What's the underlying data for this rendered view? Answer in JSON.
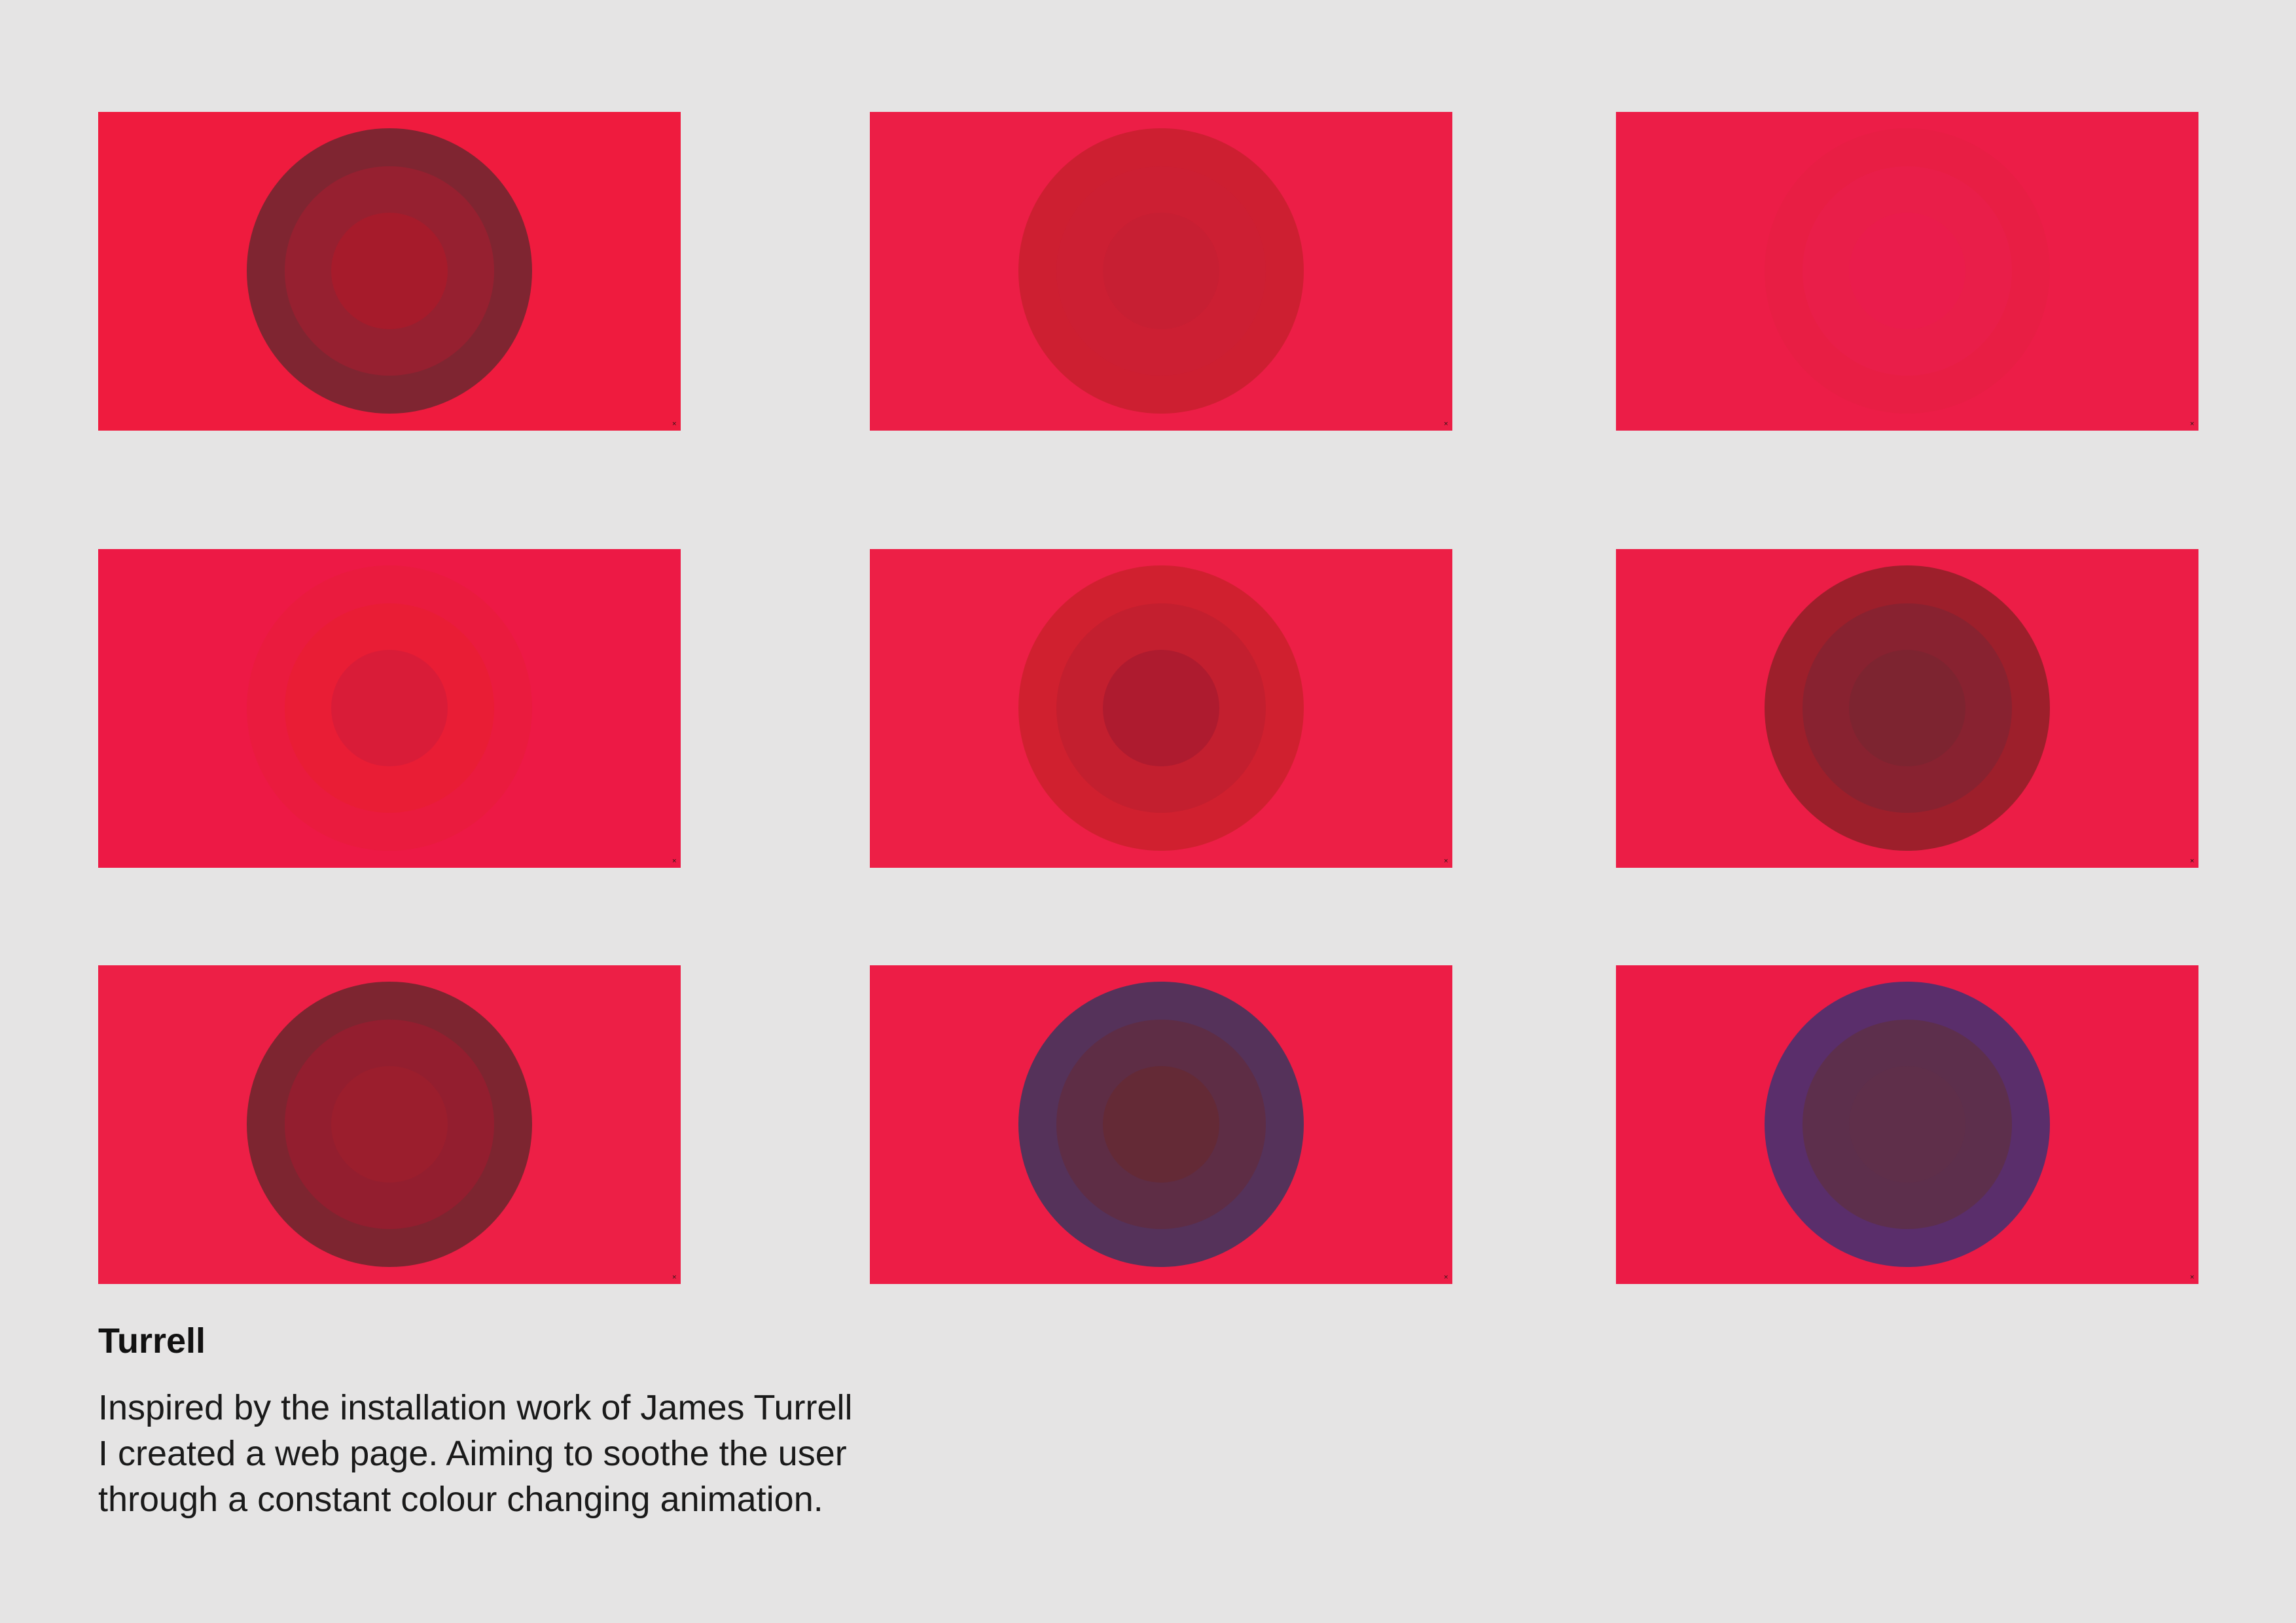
{
  "project": {
    "title": "Turrell",
    "description_lines": [
      "Inspired by the installation work of James Turrell",
      "I created a web page. Aiming to soothe the user",
      "through a constant colour changing animation."
    ]
  },
  "screens": [
    {
      "background": "#ef1b3e",
      "outer": "#7f2531",
      "middle": "#962030",
      "inner": "#a61b2b",
      "close_glyph": "×"
    },
    {
      "background": "#ec1e46",
      "outer": "#cd1f31",
      "middle": "#cc1f33",
      "inner": "#c71f33",
      "close_glyph": "×"
    },
    {
      "background": "#ec1d47",
      "outer": "#e81e44",
      "middle": "#e91e49",
      "inner": "#ea1c4c",
      "close_glyph": "×"
    },
    {
      "background": "#ed1945",
      "outer": "#ea1b3e",
      "middle": "#e91d35",
      "inner": "#d91c38",
      "close_glyph": "×"
    },
    {
      "background": "#ed1f46",
      "outer": "#d0202f",
      "middle": "#c31f2f",
      "inner": "#ae1b2f",
      "close_glyph": "×"
    },
    {
      "background": "#ec1d46",
      "outer": "#9d1f2b",
      "middle": "#882230",
      "inner": "#7d2430",
      "close_glyph": "×"
    },
    {
      "background": "#ed1f46",
      "outer": "#7d2530",
      "middle": "#931e2f",
      "inner": "#9b1e2d",
      "close_glyph": "×"
    },
    {
      "background": "#ed1d46",
      "outer": "#55325a",
      "middle": "#5e2d45",
      "inner": "#642a36",
      "close_glyph": "×"
    },
    {
      "background": "#ec1b46",
      "outer": "#5a2e6b",
      "middle": "#5d2f4c",
      "inner": "#5f2f4a",
      "close_glyph": "×"
    }
  ]
}
